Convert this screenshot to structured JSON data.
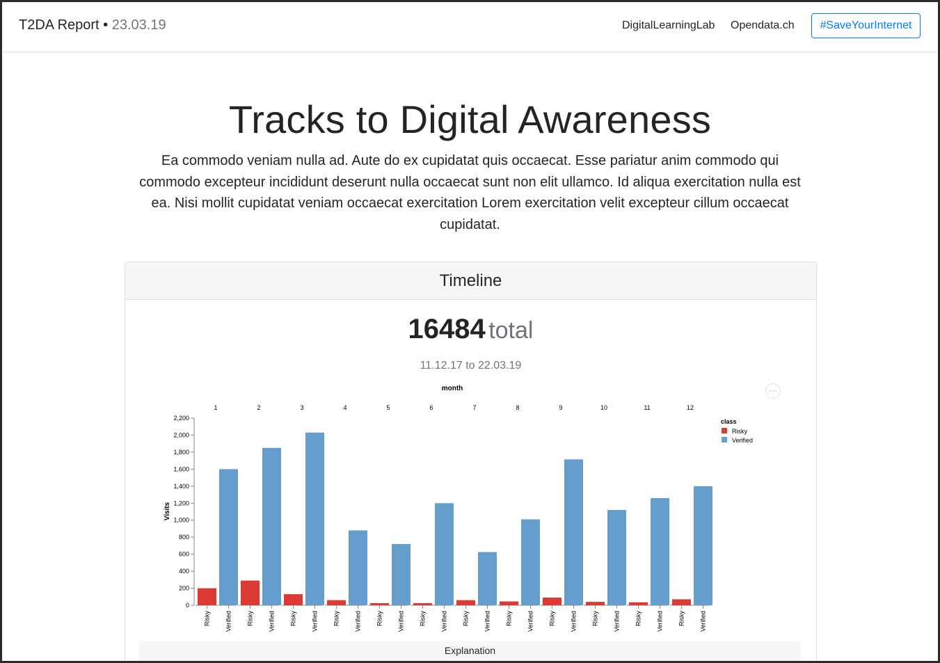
{
  "navbar": {
    "brand": "T2DA Report",
    "separator": " • ",
    "date": "23.03.19",
    "links": [
      "DigitalLearningLab",
      "Opendata.ch"
    ],
    "button": "#SaveYourInternet"
  },
  "hero": {
    "title": "Tracks to Digital Awareness",
    "text": "Ea commodo veniam nulla ad. Aute do ex cupidatat quis occaecat. Esse pariatur anim commodo qui commodo excepteur incididunt deserunt nulla occaecat sunt non elit ullamco. Id aliqua exercitation nulla est ea. Nisi mollit cupidatat veniam occaecat exercitation Lorem exercitation velit excepteur cillum occaecat cupidatat."
  },
  "timeline": {
    "header": "Timeline",
    "total_value": "16484",
    "total_label": "total",
    "range": "11.12.17 to 22.03.19",
    "menu_icon": "ellipsis-icon",
    "menu_glyph": "···",
    "explanation": "Explanation"
  },
  "chart_data": {
    "type": "bar",
    "facet_title": "month",
    "facets": [
      "1",
      "2",
      "3",
      "4",
      "5",
      "6",
      "7",
      "8",
      "9",
      "10",
      "11",
      "12"
    ],
    "categories": [
      "Risky",
      "Verified"
    ],
    "series": [
      {
        "name": "Risky",
        "color": "#dc3a35",
        "values": [
          200,
          290,
          130,
          60,
          25,
          25,
          60,
          45,
          90,
          40,
          35,
          70
        ]
      },
      {
        "name": "Verified",
        "color": "#659ecd",
        "values": [
          1600,
          1850,
          2030,
          880,
          720,
          1200,
          625,
          1010,
          1715,
          1120,
          1260,
          1400
        ]
      }
    ],
    "ylabel": "Visits",
    "yticks": [
      "0",
      "200",
      "400",
      "600",
      "800",
      "1,000",
      "1,200",
      "1,400",
      "1,600",
      "1,800",
      "2,000",
      "2,200"
    ],
    "ylim": [
      0,
      2200
    ],
    "legend_title": "class",
    "legend_position": "top-right",
    "grid": false
  }
}
